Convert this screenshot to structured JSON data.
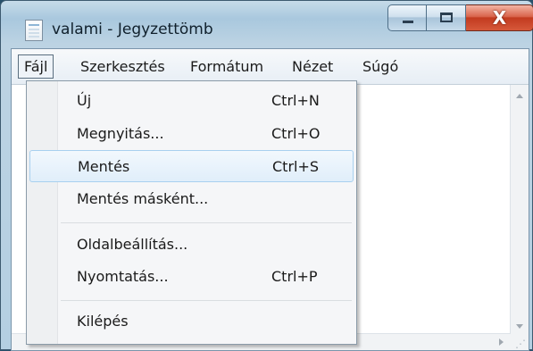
{
  "window": {
    "title": "valami - Jegyzettömb"
  },
  "menubar": {
    "items": [
      {
        "label": "Fájl"
      },
      {
        "label": "Szerkesztés"
      },
      {
        "label": "Formátum"
      },
      {
        "label": "Nézet"
      },
      {
        "label": "Súgó"
      }
    ]
  },
  "file_menu": {
    "items": [
      {
        "label": "Új",
        "shortcut": "Ctrl+N"
      },
      {
        "label": "Megnyitás...",
        "shortcut": "Ctrl+O"
      },
      {
        "label": "Mentés",
        "shortcut": "Ctrl+S",
        "highlighted": true
      },
      {
        "label": "Mentés másként..."
      },
      {
        "label": "Oldalbeállítás..."
      },
      {
        "label": "Nyomtatás...",
        "shortcut": "Ctrl+P"
      },
      {
        "label": "Kilépés"
      }
    ]
  },
  "caption_buttons": {
    "minimize_icon": "minimize-icon",
    "maximize_icon": "maximize-icon",
    "close_icon": "close-icon",
    "close_glyph": "X"
  },
  "colors": {
    "highlight_border": "#a8d0ef",
    "close_button": "#c23b1f"
  }
}
